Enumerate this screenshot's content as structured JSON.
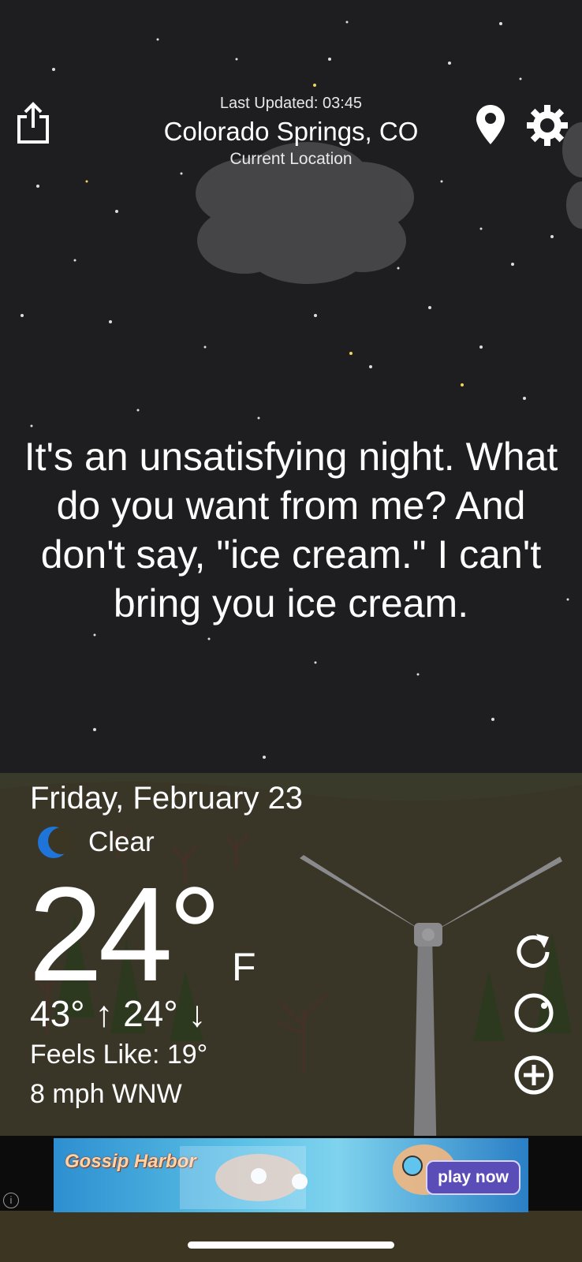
{
  "header": {
    "last_updated": "Last Updated: 03:45",
    "city": "Colorado Springs, CO",
    "location_label": "Current Location"
  },
  "quote": "It's an unsatisfying night. What do you want from me? And don't say, \"ice cream.\" I can't bring you ice cream.",
  "weather": {
    "date": "Friday, February 23",
    "condition": "Clear",
    "temperature": "24°",
    "unit": "F",
    "hi_lo": "43° ↑ 24° ↓",
    "feels_like": "Feels Like: 19°",
    "wind": "8 mph WNW"
  },
  "ad": {
    "brand": "Gossip Harbor",
    "cta": "play now"
  },
  "icons": {
    "share": "share-icon",
    "location": "location-pin-icon",
    "settings": "gear-icon",
    "refresh": "refresh-icon",
    "moon_phase": "moon-phase-icon",
    "add": "add-icon",
    "condition": "crescent-moon-icon"
  },
  "colors": {
    "sky": "#1e1e20",
    "ground": "#3b3522",
    "moon": "#1e74d9"
  }
}
